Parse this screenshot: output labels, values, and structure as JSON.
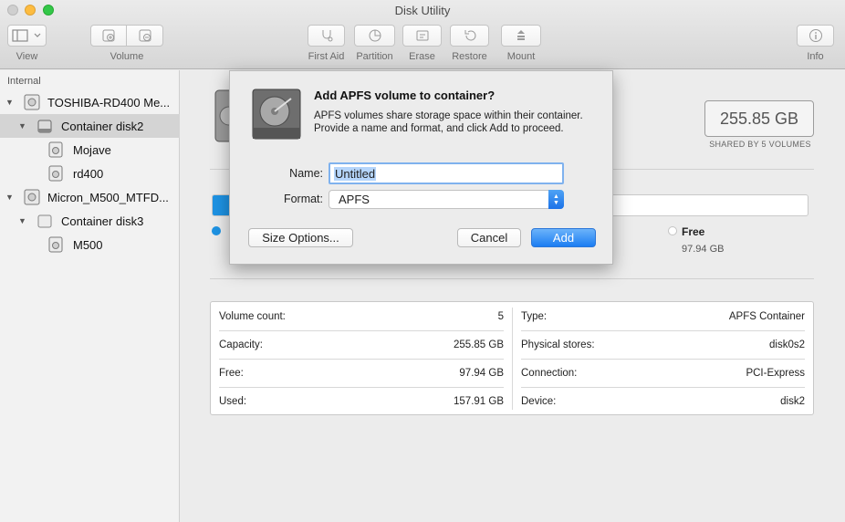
{
  "window": {
    "title": "Disk Utility"
  },
  "toolbar": {
    "view_label": "View",
    "volume_label": "Volume",
    "first_aid_label": "First Aid",
    "partition_label": "Partition",
    "erase_label": "Erase",
    "restore_label": "Restore",
    "mount_label": "Mount",
    "info_label": "Info"
  },
  "sidebar": {
    "section": "Internal",
    "items": [
      {
        "label": "TOSHIBA-RD400 Me..."
      },
      {
        "label": "Container disk2"
      },
      {
        "label": "Mojave"
      },
      {
        "label": "rd400"
      },
      {
        "label": "Micron_M500_MTFD..."
      },
      {
        "label": "Container disk3"
      },
      {
        "label": "M500"
      }
    ]
  },
  "main": {
    "size": "255.85 GB",
    "size_sub": "SHARED BY 5 VOLUMES",
    "used_fraction": 0.617,
    "free_label": "Free",
    "free_value": "97.94 GB",
    "info": {
      "left": [
        {
          "label": "Volume count:",
          "value": "5"
        },
        {
          "label": "Capacity:",
          "value": "255.85 GB"
        },
        {
          "label": "Free:",
          "value": "97.94 GB"
        },
        {
          "label": "Used:",
          "value": "157.91 GB"
        }
      ],
      "right": [
        {
          "label": "Type:",
          "value": "APFS Container"
        },
        {
          "label": "Physical stores:",
          "value": "disk0s2"
        },
        {
          "label": "Connection:",
          "value": "PCI-Express"
        },
        {
          "label": "Device:",
          "value": "disk2"
        }
      ]
    }
  },
  "dialog": {
    "title": "Add APFS volume to container?",
    "message": "APFS volumes share storage space within their container. Provide a name and format, and click Add to proceed.",
    "name_label": "Name:",
    "name_value": "Untitled",
    "format_label": "Format:",
    "format_value": "APFS",
    "size_options_label": "Size Options...",
    "cancel_label": "Cancel",
    "add_label": "Add"
  },
  "colors": {
    "accent": "#1b7df2",
    "used": "#1e93e4"
  }
}
